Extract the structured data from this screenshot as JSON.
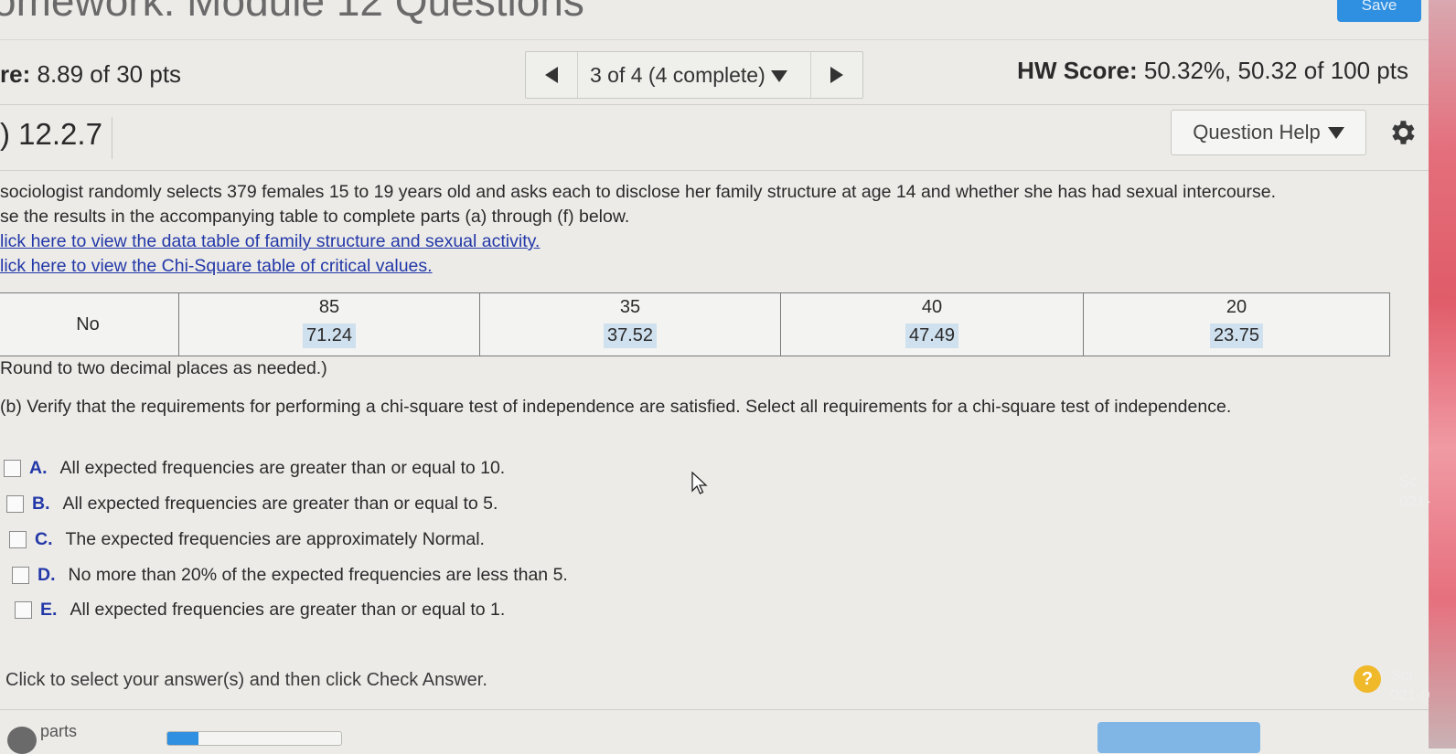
{
  "header": {
    "title": "omework: Module 12 Questions",
    "save_label": "Save"
  },
  "score_bar": {
    "question_score_prefix": "re:",
    "question_score_value": "8.89 of 30 pts",
    "nav_label": "3 of 4 (4 complete)",
    "hw_score_label": "HW Score:",
    "hw_score_value": "50.32%, 50.32 of 100 pts"
  },
  "question": {
    "number": "12.2.7",
    "help_label": "Question Help",
    "prompt_line1": "sociologist randomly selects 379 females 15 to 19 years old and asks each to disclose her family structure at age 14 and whether she has had sexual intercourse.",
    "prompt_line2": "se the results in the accompanying table to complete parts (a) through (f) below.",
    "link1": "lick here to view the data table of family structure and sexual activity.",
    "link2": "lick here to view the Chi-Square table of critical values."
  },
  "table": {
    "row_label": "No",
    "cells": [
      {
        "observed": "85",
        "expected": "71.24"
      },
      {
        "observed": "35",
        "expected": "37.52"
      },
      {
        "observed": "40",
        "expected": "47.49"
      },
      {
        "observed": "20",
        "expected": "23.75"
      }
    ]
  },
  "round_note": "Round to two decimal places as needed.)",
  "part_b": "(b) Verify that the requirements for performing a chi-square test of independence are satisfied. Select all requirements for a chi-square test of independence.",
  "choices": [
    {
      "letter": "A.",
      "text": "All expected frequencies are greater than or equal to 10."
    },
    {
      "letter": "B.",
      "text": "All expected frequencies are greater than or equal to 5."
    },
    {
      "letter": "C.",
      "text": "The expected frequencies are approximately Normal."
    },
    {
      "letter": "D.",
      "text": "No more than 20% of the expected frequencies are less than 5."
    },
    {
      "letter": "E.",
      "text": "All expected frequencies are greater than or equal to 1."
    }
  ],
  "instruction": "Click to select your answer(s) and then click Check Answer.",
  "help_symbol": "?",
  "footer": {
    "parts_label": "parts"
  },
  "side": {
    "text1a": "Sc",
    "text1b": "021-",
    "text2a": "Scr",
    "text2b": "021-0"
  },
  "colors": {
    "accent": "#2f8fe0",
    "link": "#2338a8",
    "expected_highlight": "#cfe0ee"
  }
}
